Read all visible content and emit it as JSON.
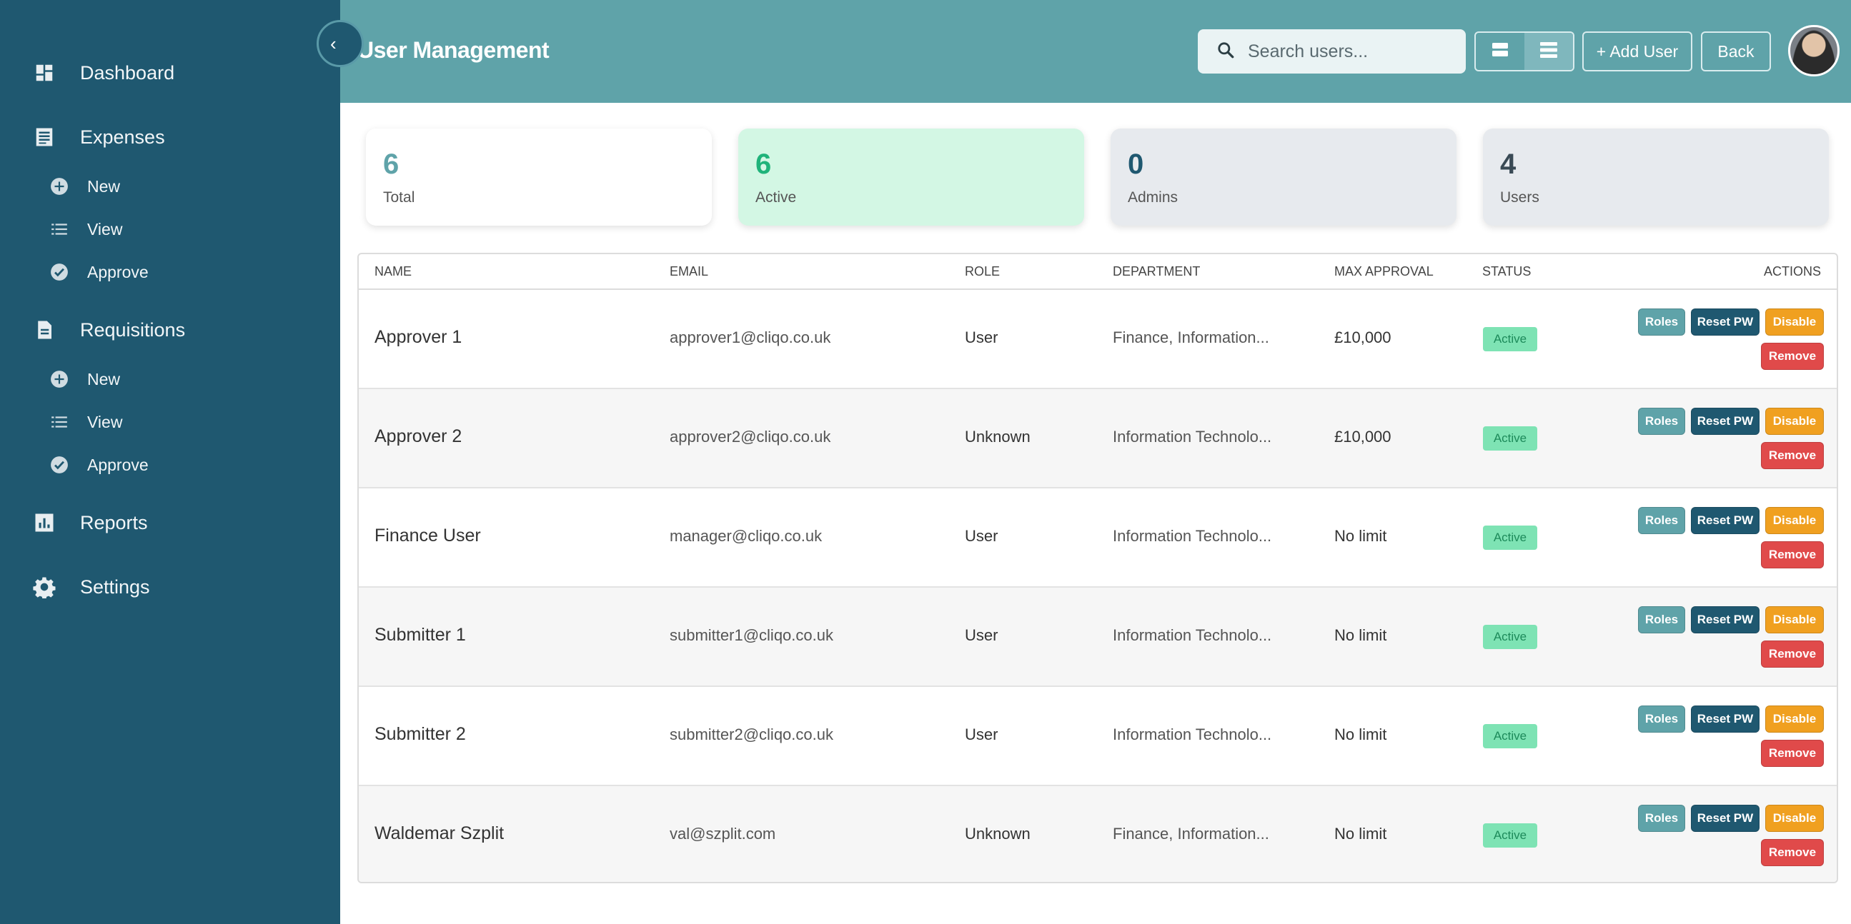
{
  "sidebar": {
    "collapse_icon": "chevron-left-icon",
    "items": [
      {
        "label": "Dashboard",
        "icon": "dashboard-icon"
      },
      {
        "label": "Expenses",
        "icon": "receipt-icon"
      },
      {
        "label": "New",
        "icon": "plus-circle-icon"
      },
      {
        "label": "View",
        "icon": "list-icon"
      },
      {
        "label": "Approve",
        "icon": "check-circle-icon"
      },
      {
        "label": "Requisitions",
        "icon": "document-icon"
      },
      {
        "label": "New",
        "icon": "plus-circle-icon"
      },
      {
        "label": "View",
        "icon": "list-icon"
      },
      {
        "label": "Approve",
        "icon": "check-circle-icon"
      },
      {
        "label": "Reports",
        "icon": "bar-chart-icon"
      },
      {
        "label": "Settings",
        "icon": "gear-icon"
      }
    ]
  },
  "header": {
    "title": "User Management",
    "search_placeholder": "Search users...",
    "add_user_label": "+ Add User",
    "back_label": "Back"
  },
  "stats": [
    {
      "value": "6",
      "label": "Total"
    },
    {
      "value": "6",
      "label": "Active"
    },
    {
      "value": "0",
      "label": "Admins"
    },
    {
      "value": "4",
      "label": "Users"
    }
  ],
  "table": {
    "columns": [
      "Name",
      "Email",
      "Role",
      "Department",
      "Max Approval",
      "Status",
      "Actions"
    ],
    "rows": [
      {
        "name": "Approver 1",
        "email": "approver1@cliqo.co.uk",
        "role": "User",
        "department": "Finance, Information...",
        "max_approval": "£10,000",
        "status": "Active"
      },
      {
        "name": "Approver 2",
        "email": "approver2@cliqo.co.uk",
        "role": "Unknown",
        "department": "Information Technolo...",
        "max_approval": "£10,000",
        "status": "Active"
      },
      {
        "name": "Finance User",
        "email": "manager@cliqo.co.uk",
        "role": "User",
        "department": "Information Technolo...",
        "max_approval": "No limit",
        "status": "Active"
      },
      {
        "name": "Submitter 1",
        "email": "submitter1@cliqo.co.uk",
        "role": "User",
        "department": "Information Technolo...",
        "max_approval": "No limit",
        "status": "Active"
      },
      {
        "name": "Submitter 2",
        "email": "submitter2@cliqo.co.uk",
        "role": "User",
        "department": "Information Technolo...",
        "max_approval": "No limit",
        "status": "Active"
      },
      {
        "name": "Waldemar Szplit",
        "email": "val@szplit.com",
        "role": "Unknown",
        "department": "Finance, Information...",
        "max_approval": "No limit",
        "status": "Active"
      }
    ],
    "actions": {
      "roles": "Roles",
      "reset": "Reset PW",
      "disable": "Disable",
      "remove": "Remove"
    }
  },
  "colors": {
    "sidebar": "#1f5870",
    "header": "#5fa3a9",
    "active_badge": "#7ee3b4",
    "disable": "#f0a020",
    "remove": "#e04a4a"
  }
}
